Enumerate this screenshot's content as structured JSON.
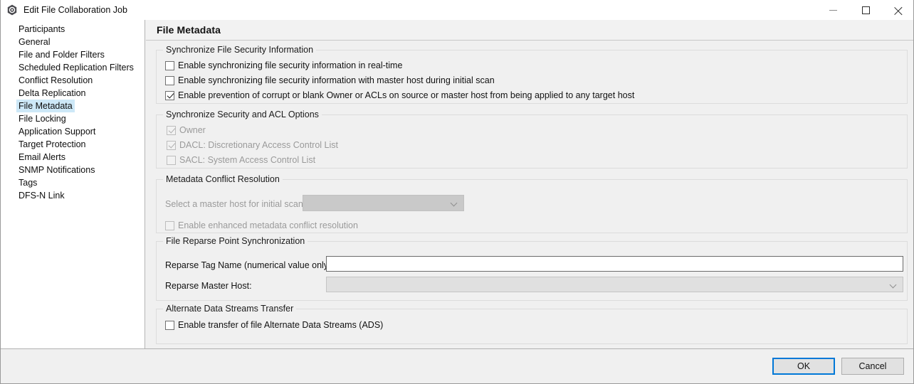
{
  "window": {
    "title": "Edit File Collaboration Job",
    "app_icon": "hexagon-app-icon",
    "controls": {
      "minimize": "minimize-icon",
      "maximize": "maximize-icon",
      "close": "close-icon"
    }
  },
  "sidebar": {
    "items": [
      {
        "label": "Participants",
        "selected": false
      },
      {
        "label": "General",
        "selected": false
      },
      {
        "label": "File and Folder Filters",
        "selected": false
      },
      {
        "label": "Scheduled Replication Filters",
        "selected": false
      },
      {
        "label": "Conflict Resolution",
        "selected": false
      },
      {
        "label": "Delta Replication",
        "selected": false
      },
      {
        "label": "File Metadata",
        "selected": true
      },
      {
        "label": "File Locking",
        "selected": false
      },
      {
        "label": "Application Support",
        "selected": false
      },
      {
        "label": "Target Protection",
        "selected": false
      },
      {
        "label": "Email Alerts",
        "selected": false
      },
      {
        "label": "SNMP Notifications",
        "selected": false
      },
      {
        "label": "Tags",
        "selected": false
      },
      {
        "label": "DFS-N Link",
        "selected": false
      }
    ]
  },
  "pane": {
    "title": "File Metadata"
  },
  "groups": {
    "security_info": {
      "title": "Synchronize File Security Information",
      "checkboxes": [
        {
          "label": "Enable synchronizing file security information in real-time",
          "checked": false,
          "disabled": false
        },
        {
          "label": "Enable synchronizing file security information with master host during initial scan",
          "checked": false,
          "disabled": false
        },
        {
          "label": "Enable prevention of corrupt or blank Owner or ACLs on source or master host from being applied to any target host",
          "checked": true,
          "disabled": false
        }
      ]
    },
    "acl_options": {
      "title": "Synchronize Security and ACL Options",
      "checkboxes": [
        {
          "label": "Owner",
          "checked": true,
          "disabled": true
        },
        {
          "label": "DACL: Discretionary Access Control List",
          "checked": true,
          "disabled": true
        },
        {
          "label": "SACL: System Access Control List",
          "checked": false,
          "disabled": true
        }
      ]
    },
    "metadata_conflict": {
      "title": "Metadata Conflict Resolution",
      "master_host_label": "Select a master host for initial scan:",
      "master_host_value": "",
      "master_host_disabled": true,
      "checkbox": {
        "label": "Enable enhanced metadata conflict resolution",
        "checked": false,
        "disabled": true
      }
    },
    "reparse": {
      "title": "File Reparse Point Synchronization",
      "tag_name_label": "Reparse Tag Name (numerical value only):",
      "tag_name_value": "",
      "tag_name_placeholder": "",
      "master_host_label": "Reparse Master Host:",
      "master_host_value": "",
      "master_host_disabled": true
    },
    "ads": {
      "title": "Alternate Data Streams Transfer",
      "checkbox": {
        "label": "Enable transfer of file Alternate Data Streams (ADS)",
        "checked": false,
        "disabled": false
      }
    }
  },
  "footer": {
    "ok_label": "OK",
    "cancel_label": "Cancel"
  },
  "colors": {
    "accent": "#0078d7",
    "selection": "#cde8f7",
    "window_bg": "#f0f0f0",
    "sidebar_bg": "#ffffff"
  }
}
